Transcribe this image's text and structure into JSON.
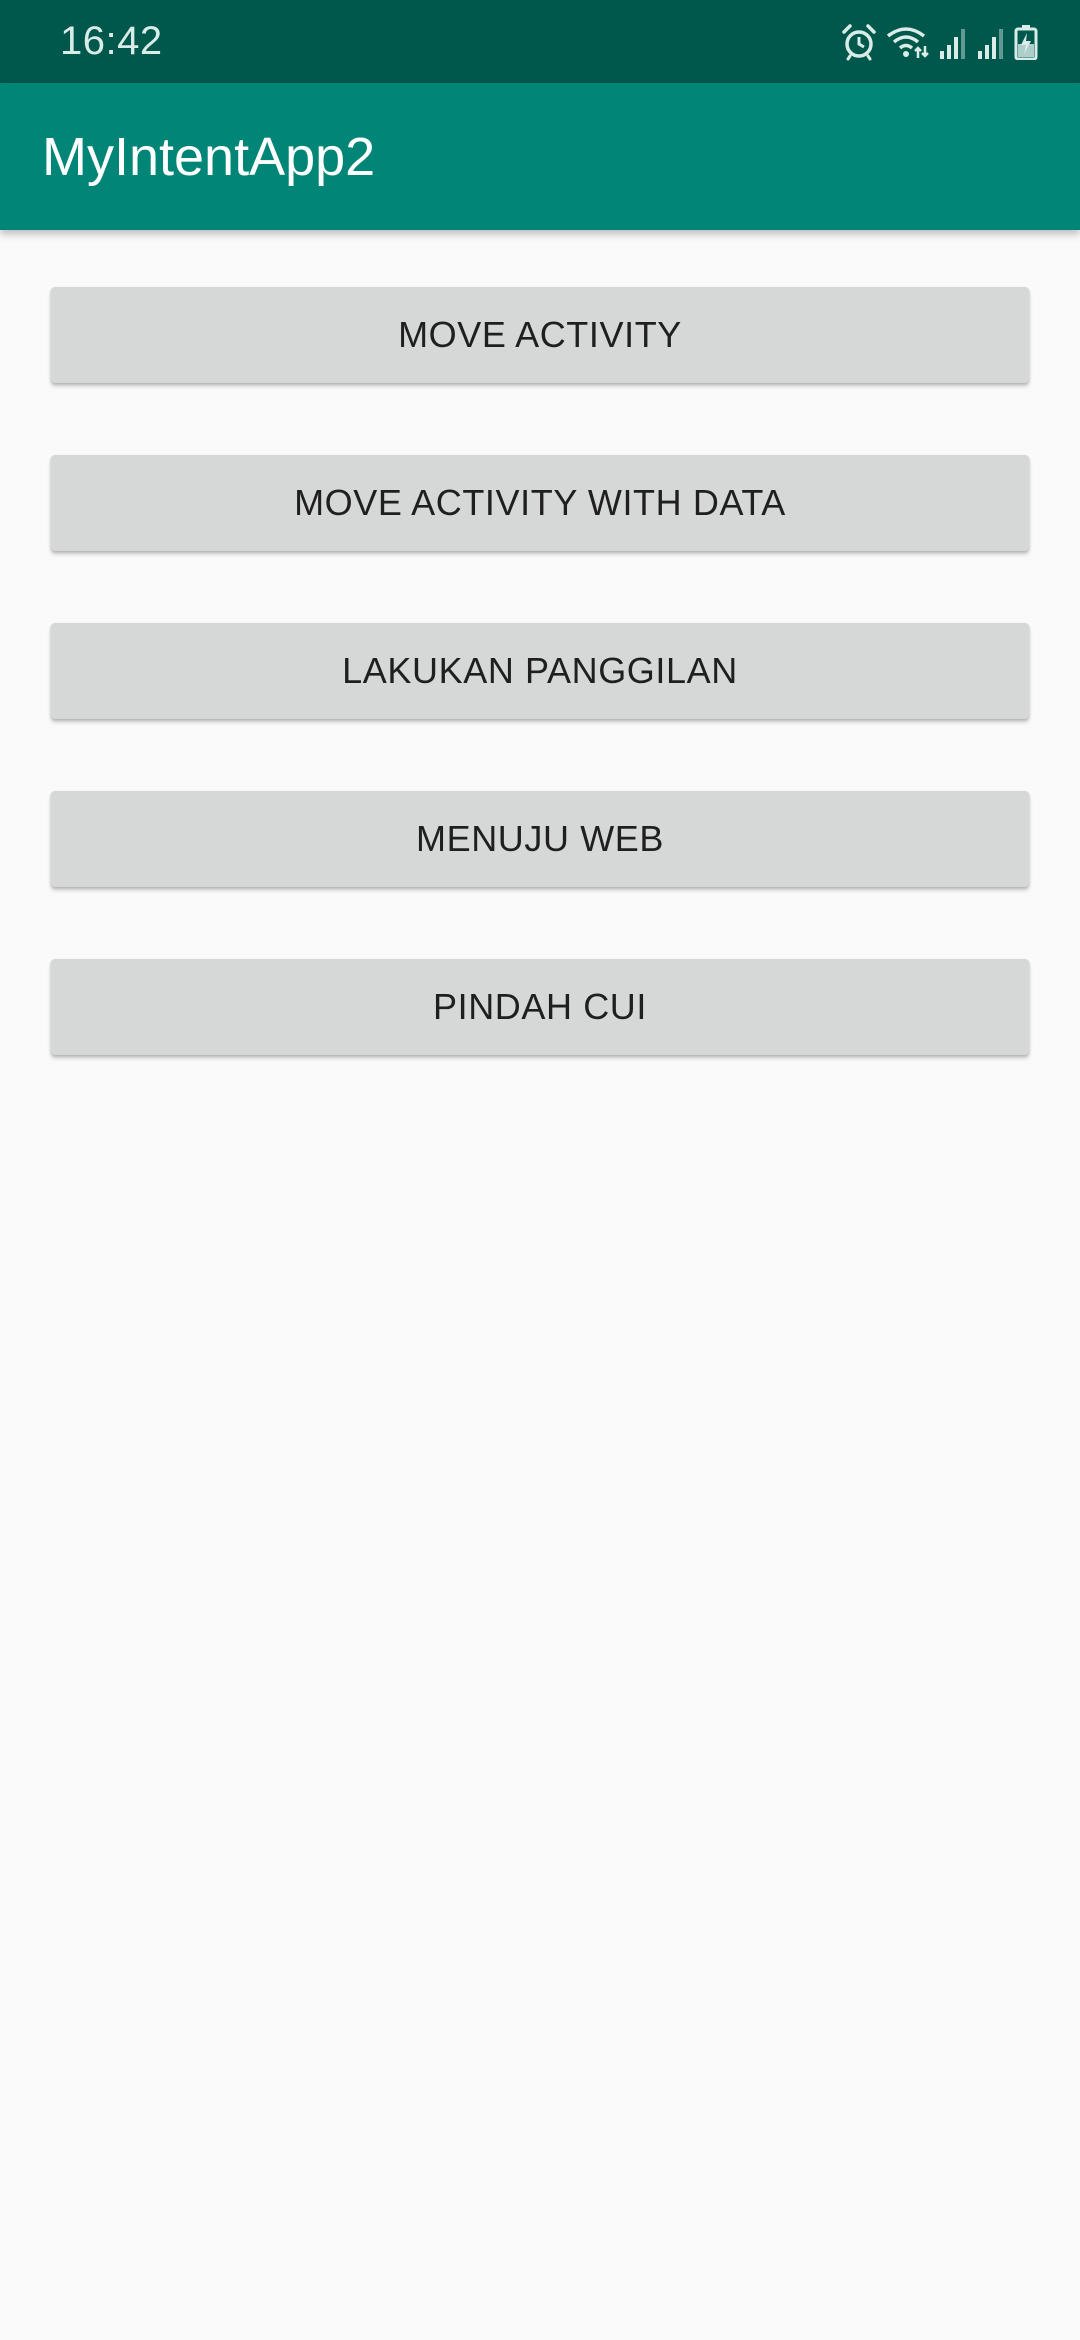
{
  "status_bar": {
    "time": "16:42",
    "icons": [
      "alarm-icon",
      "wifi-icon",
      "signal-icon",
      "signal-icon",
      "battery-charging-icon"
    ]
  },
  "app_bar": {
    "title": "MyIntentApp2",
    "color": "#008577",
    "status_color": "#00574b"
  },
  "buttons": [
    {
      "label": "MOVE ACTIVITY"
    },
    {
      "label": "MOVE ACTIVITY WITH DATA"
    },
    {
      "label": "LAKUKAN PANGGILAN"
    },
    {
      "label": "MENUJU WEB"
    },
    {
      "label": "PINDAH CUI"
    }
  ]
}
